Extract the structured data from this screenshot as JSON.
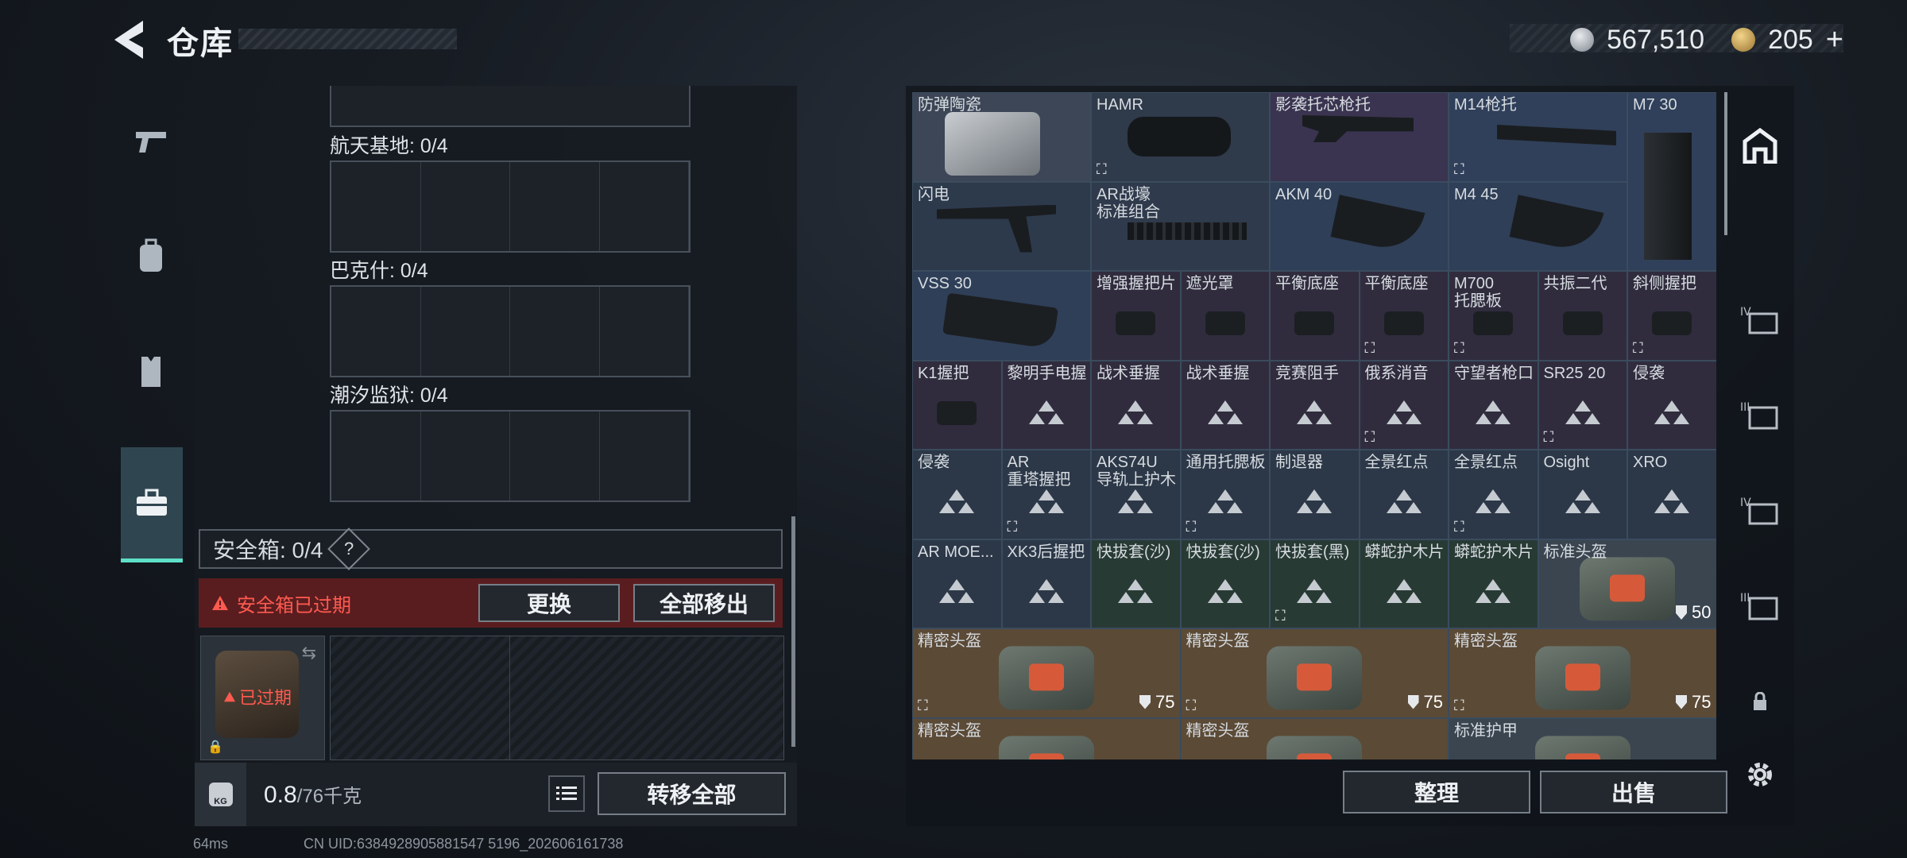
{
  "header": {
    "title": "仓库",
    "currency": [
      {
        "icon": "silver-coin-icon",
        "value": "567,510"
      },
      {
        "icon": "gold-coin-icon",
        "value": "205"
      }
    ],
    "add_symbol": "+"
  },
  "left_nav": [
    {
      "icon": "pistol-icon"
    },
    {
      "icon": "backpack-icon"
    },
    {
      "icon": "vest-icon"
    },
    {
      "icon": "toolbox-icon",
      "active": true
    }
  ],
  "slots": [
    {
      "label": "航天基地: 0/4"
    },
    {
      "label": "巴克什: 0/4"
    },
    {
      "label": "潮汐监狱: 0/4"
    }
  ],
  "safebox": {
    "label": "安全箱: 0/4",
    "help": "?",
    "expired_text": "安全箱已过期",
    "replace_label": "更换",
    "move_all_label": "全部移出",
    "case_badge": "已过期"
  },
  "bottom": {
    "weight": "0.8",
    "capacity": "/76千克",
    "transfer_label": "转移全部",
    "kg_label": "KG"
  },
  "grid_cells": [
    {
      "name": "防弹陶瓷",
      "col": 0,
      "row": 0,
      "w": 1,
      "h": 1,
      "bg": "#3c4656",
      "item": "plate"
    },
    {
      "name": "HAMR",
      "col": 1,
      "row": 0,
      "w": 1,
      "h": 1,
      "bg": "#2f3a4a",
      "lock": true,
      "item": "scope"
    },
    {
      "name": "影袭托芯枪托",
      "col": 2,
      "row": 0,
      "w": 1,
      "h": 1,
      "bg": "#3a3450",
      "item": "stock"
    },
    {
      "name": "M14枪托",
      "col": 3,
      "row": 0,
      "w": 1,
      "h": 1,
      "bg": "#30405a",
      "lock": true,
      "item": "stock2"
    },
    {
      "name": "M7 30",
      "col": 4,
      "row": 0,
      "w": 0.5,
      "h": 2,
      "bg": "#30405a",
      "item": "mag"
    },
    {
      "name": "闪电",
      "col": 0,
      "row": 1,
      "w": 1,
      "h": 1,
      "bg": "#2d3a4c",
      "item": "stock3"
    },
    {
      "name": "AR战壕\n标准组合",
      "col": 1,
      "row": 1,
      "w": 1,
      "h": 1,
      "bg": "#2f3a4c",
      "item": "rail"
    },
    {
      "name": "AKM 40",
      "col": 2,
      "row": 1,
      "w": 1,
      "h": 1,
      "bg": "#2f3f58",
      "item": "curvemag"
    },
    {
      "name": "M4 45",
      "col": 3,
      "row": 1,
      "w": 1,
      "h": 1,
      "bg": "#2f3f58",
      "item": "curvemag"
    },
    {
      "name": "VSS 30",
      "col": 0,
      "row": 2,
      "w": 1,
      "h": 1,
      "bg": "#2f3f58",
      "item": "vssmag"
    },
    {
      "name": "增强握把片",
      "col": 1,
      "row": 2,
      "w": 0.5,
      "h": 1,
      "bg": "#302c3e",
      "item": "small"
    },
    {
      "name": "遮光罩",
      "col": 1.5,
      "row": 2,
      "w": 0.5,
      "h": 1,
      "bg": "#302c3e",
      "item": "small"
    },
    {
      "name": "平衡底座",
      "col": 2,
      "row": 2,
      "w": 0.5,
      "h": 1,
      "bg": "#302c3e",
      "item": "small"
    },
    {
      "name": "平衡底座",
      "col": 2.5,
      "row": 2,
      "w": 0.5,
      "h": 1,
      "bg": "#302c3e",
      "lock": true,
      "item": "small"
    },
    {
      "name": "M700\n托腮板",
      "col": 3,
      "row": 2,
      "w": 0.5,
      "h": 1,
      "bg": "#302c3e",
      "lock": true,
      "item": "small"
    },
    {
      "name": "共振二代",
      "col": 3.5,
      "row": 2,
      "w": 0.5,
      "h": 1,
      "bg": "#302c3e",
      "item": "small"
    },
    {
      "name": "斜侧握把",
      "col": 4,
      "row": 2,
      "w": 0.5,
      "h": 1,
      "bg": "#302c3e",
      "lock": true,
      "item": "small"
    },
    {
      "name": "K1握把",
      "col": 0,
      "row": 3,
      "w": 0.5,
      "h": 1,
      "bg": "#302c3e",
      "item": "small"
    },
    {
      "name": "黎明手电握",
      "col": 0.5,
      "row": 3,
      "w": 0.5,
      "h": 1,
      "bg": "#302c3e",
      "item": "tri"
    },
    {
      "name": "战术垂握",
      "col": 1,
      "row": 3,
      "w": 0.5,
      "h": 1,
      "bg": "#302c3e",
      "item": "tri"
    },
    {
      "name": "战术垂握",
      "col": 1.5,
      "row": 3,
      "w": 0.5,
      "h": 1,
      "bg": "#302c3e",
      "item": "tri"
    },
    {
      "name": "竞赛阻手",
      "col": 2,
      "row": 3,
      "w": 0.5,
      "h": 1,
      "bg": "#302c3e",
      "item": "tri"
    },
    {
      "name": "俄系消音",
      "col": 2.5,
      "row": 3,
      "w": 0.5,
      "h": 1,
      "bg": "#302c3e",
      "lock": true,
      "item": "tri"
    },
    {
      "name": "守望者枪口",
      "col": 3,
      "row": 3,
      "w": 0.5,
      "h": 1,
      "bg": "#302c3e",
      "item": "tri"
    },
    {
      "name": "SR25 20",
      "col": 3.5,
      "row": 3,
      "w": 0.5,
      "h": 1,
      "bg": "#302c3e",
      "lock": true,
      "item": "tri"
    },
    {
      "name": "侵袭",
      "col": 4,
      "row": 3,
      "w": 0.5,
      "h": 1,
      "bg": "#302c3e",
      "item": "tri"
    },
    {
      "name": "侵袭",
      "col": 0,
      "row": 4,
      "w": 0.5,
      "h": 1,
      "bg": "#2c3848",
      "item": "tri"
    },
    {
      "name": "AR\n重塔握把",
      "col": 0.5,
      "row": 4,
      "w": 0.5,
      "h": 1,
      "bg": "#2c3848",
      "lock": true,
      "item": "tri"
    },
    {
      "name": "AKS74U\n导轨上护木",
      "col": 1,
      "row": 4,
      "w": 0.5,
      "h": 1,
      "bg": "#2c3848",
      "item": "tri"
    },
    {
      "name": "通用托腮板",
      "col": 1.5,
      "row": 4,
      "w": 0.5,
      "h": 1,
      "bg": "#2c3848",
      "lock": true,
      "item": "tri"
    },
    {
      "name": "制退器",
      "col": 2,
      "row": 4,
      "w": 0.5,
      "h": 1,
      "bg": "#2c3848",
      "item": "tri"
    },
    {
      "name": "全景红点",
      "col": 2.5,
      "row": 4,
      "w": 0.5,
      "h": 1,
      "bg": "#2c3848",
      "item": "tri"
    },
    {
      "name": "全景红点",
      "col": 3,
      "row": 4,
      "w": 0.5,
      "h": 1,
      "bg": "#2c3848",
      "lock": true,
      "item": "tri"
    },
    {
      "name": "Osight",
      "col": 3.5,
      "row": 4,
      "w": 0.5,
      "h": 1,
      "bg": "#2c3848",
      "item": "tri"
    },
    {
      "name": "XRO",
      "col": 4,
      "row": 4,
      "w": 0.5,
      "h": 1,
      "bg": "#2c3848",
      "item": "tri"
    },
    {
      "name": "AR MOE...",
      "col": 0,
      "row": 5,
      "w": 0.5,
      "h": 1,
      "bg": "#2c3848",
      "item": "tri"
    },
    {
      "name": "XK3后握把",
      "col": 0.5,
      "row": 5,
      "w": 0.5,
      "h": 1,
      "bg": "#2c3848",
      "item": "tri"
    },
    {
      "name": "快拔套(沙)",
      "col": 1,
      "row": 5,
      "w": 0.5,
      "h": 1,
      "bg": "#283a34",
      "item": "tri"
    },
    {
      "name": "快拔套(沙)",
      "col": 1.5,
      "row": 5,
      "w": 0.5,
      "h": 1,
      "bg": "#283a34",
      "item": "tri"
    },
    {
      "name": "快拔套(黑)",
      "col": 2,
      "row": 5,
      "w": 0.5,
      "h": 1,
      "bg": "#283a34",
      "lock": true,
      "item": "tri"
    },
    {
      "name": "蟒蛇护木片",
      "col": 2.5,
      "row": 5,
      "w": 0.5,
      "h": 1,
      "bg": "#283a34",
      "item": "tri"
    },
    {
      "name": "蟒蛇护木片",
      "col": 3,
      "row": 5,
      "w": 0.5,
      "h": 1,
      "bg": "#283a34",
      "item": "tri"
    },
    {
      "name": "标准头盔",
      "col": 3.5,
      "row": 5,
      "w": 1,
      "h": 1,
      "bg": "#3a4550",
      "dur": "50",
      "item": "bag"
    },
    {
      "name": "精密头盔",
      "col": 0,
      "row": 6,
      "w": 1.5,
      "h": 1,
      "bg": "#5b4a36",
      "lock": true,
      "dur": "75",
      "item": "bag"
    },
    {
      "name": "精密头盔",
      "col": 1.5,
      "row": 6,
      "w": 1.5,
      "h": 1,
      "bg": "#5b4a36",
      "lock": true,
      "dur": "75",
      "item": "bag"
    },
    {
      "name": "精密头盔",
      "col": 3,
      "row": 6,
      "w": 1.5,
      "h": 1,
      "bg": "#5b4a36",
      "lock": true,
      "dur": "75",
      "item": "bag"
    },
    {
      "name": "精密头盔",
      "col": 0,
      "row": 7,
      "w": 1.5,
      "h": 1,
      "bg": "#5b4a36",
      "item": "bag"
    },
    {
      "name": "精密头盔",
      "col": 1.5,
      "row": 7,
      "w": 1.5,
      "h": 1,
      "bg": "#5b4a36",
      "item": "bag"
    },
    {
      "name": "标准护甲",
      "col": 3,
      "row": 7,
      "w": 1.5,
      "h": 1,
      "bg": "#3a4550",
      "item": "bag"
    }
  ],
  "actions": {
    "sort_label": "整理",
    "sell_label": "出售"
  },
  "right_nav": [
    {
      "icon": "home-icon"
    },
    {
      "icon": "armor-iv-icon"
    },
    {
      "icon": "vest-iii-icon"
    },
    {
      "icon": "armor-iv-2-icon"
    },
    {
      "icon": "armor-iii-icon"
    },
    {
      "icon": "lock-icon"
    }
  ],
  "status": {
    "ping": "64ms",
    "uid": "CN UID:6384928905881547 5196_202606161738"
  }
}
